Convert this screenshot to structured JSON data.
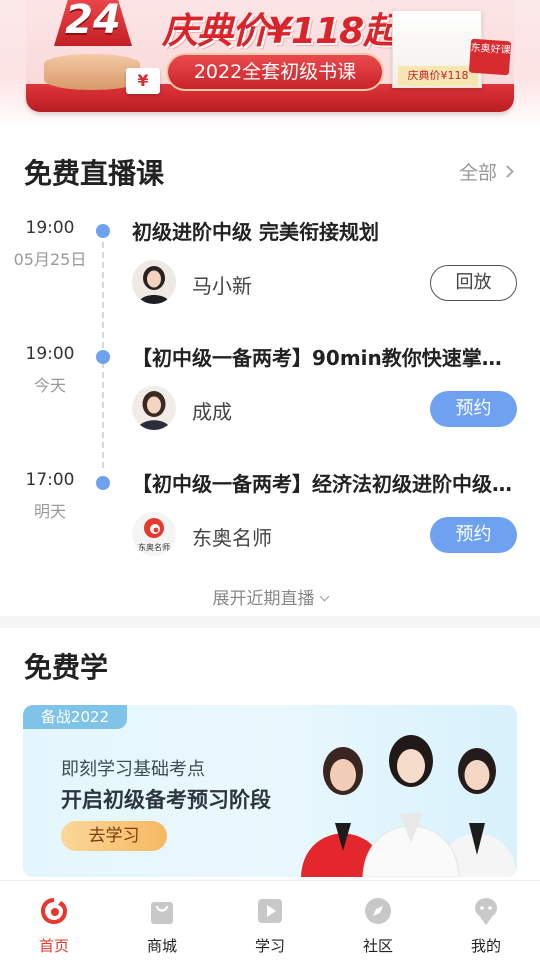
{
  "banner": {
    "anniversary": "24",
    "yen": "¥",
    "headline": "庆典价¥118起",
    "pill": "2022全套初级书课",
    "book_price": "庆典价¥118",
    "sign": "东奥好课"
  },
  "live_section": {
    "title": "免费直播课",
    "more_label": "全部",
    "items": [
      {
        "time": "19:00",
        "date": "05月25日",
        "title": "初级进阶中级 完美衔接规划",
        "teacher": "马小新",
        "action": "回放",
        "action_type": "replay"
      },
      {
        "time": "19:00",
        "date": "今天",
        "title": "【初中级一备两考】90min教你快速掌握…",
        "teacher": "成成",
        "action": "预约",
        "action_type": "book"
      },
      {
        "time": "17:00",
        "date": "明天",
        "title": "【初中级一备两考】经济法初级进阶中级…",
        "teacher": "东奥名师",
        "logo_text": "东奥名师",
        "action": "预约",
        "action_type": "book"
      }
    ],
    "expand_label": "展开近期直播"
  },
  "free_section": {
    "title": "免费学",
    "card": {
      "tag": "备战2022",
      "subtitle": "即刻学习基础考点",
      "main": "开启初级备考预习阶段",
      "button": "去学习"
    }
  },
  "nav": {
    "items": [
      {
        "label": "首页",
        "icon": "home-icon",
        "active": true
      },
      {
        "label": "商城",
        "icon": "shopping-bag-icon",
        "active": false
      },
      {
        "label": "学习",
        "icon": "play-icon",
        "active": false
      },
      {
        "label": "社区",
        "icon": "compass-icon",
        "active": false
      },
      {
        "label": "我的",
        "icon": "profile-icon",
        "active": false
      }
    ]
  },
  "colors": {
    "accent_blue": "#6ea1ef",
    "brand_red": "#e8372c",
    "banner_red": "#d8242a"
  }
}
